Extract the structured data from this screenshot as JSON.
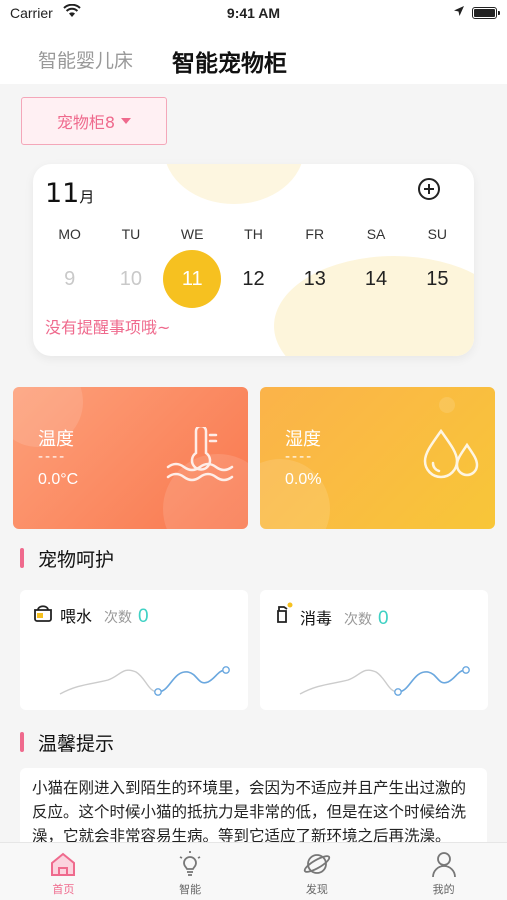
{
  "status_bar": {
    "carrier": "Carrier",
    "time": "9:41 AM"
  },
  "top_tabs": [
    {
      "label": "智能婴儿床",
      "active": false
    },
    {
      "label": "智能宠物柜",
      "active": true
    }
  ],
  "cabinet_select": {
    "label": "宠物柜8"
  },
  "calendar": {
    "month": "11",
    "month_unit": "月",
    "weekdays": [
      "MO",
      "TU",
      "WE",
      "TH",
      "FR",
      "SA",
      "SU"
    ],
    "dates": [
      "9",
      "10",
      "11",
      "12",
      "13",
      "14",
      "15"
    ],
    "today_index": 2,
    "reminder": "没有提醒事项哦~"
  },
  "environment": {
    "temperature": {
      "label": "温度",
      "dash": "----",
      "value": "0.0°C"
    },
    "humidity": {
      "label": "湿度",
      "dash": "----",
      "value": "0.0%"
    }
  },
  "care_section": {
    "title": "宠物呵护"
  },
  "care_cards": [
    {
      "name": "喂水",
      "count_label": "次数",
      "count": "0",
      "icon": "water-bowl-icon"
    },
    {
      "name": "消毒",
      "count_label": "次数",
      "count": "0",
      "icon": "disinfect-spray-icon"
    }
  ],
  "tips_section": {
    "title": "温馨提示"
  },
  "tips": {
    "text": "小猫在刚进入到陌生的环境里，会因为不适应并且产生出过激的反应。这个时候小猫的抵抗力是非常的低，但是在这个时候给洗澡，它就会非常容易生病。等到它适应了新环境之后再洗澡。"
  },
  "tab_bar": [
    {
      "label": "首页",
      "icon": "home-icon",
      "active": true
    },
    {
      "label": "智能",
      "icon": "smart-bulb-icon",
      "active": false
    },
    {
      "label": "发现",
      "icon": "planet-icon",
      "active": false
    },
    {
      "label": "我的",
      "icon": "user-icon",
      "active": false
    }
  ],
  "colors": {
    "accent_pink": "#ef6a8d",
    "today_yellow": "#f6c120",
    "count_teal": "#3fd1c4",
    "temp_card": "#f9784e",
    "hum_card": "#f8c638"
  }
}
